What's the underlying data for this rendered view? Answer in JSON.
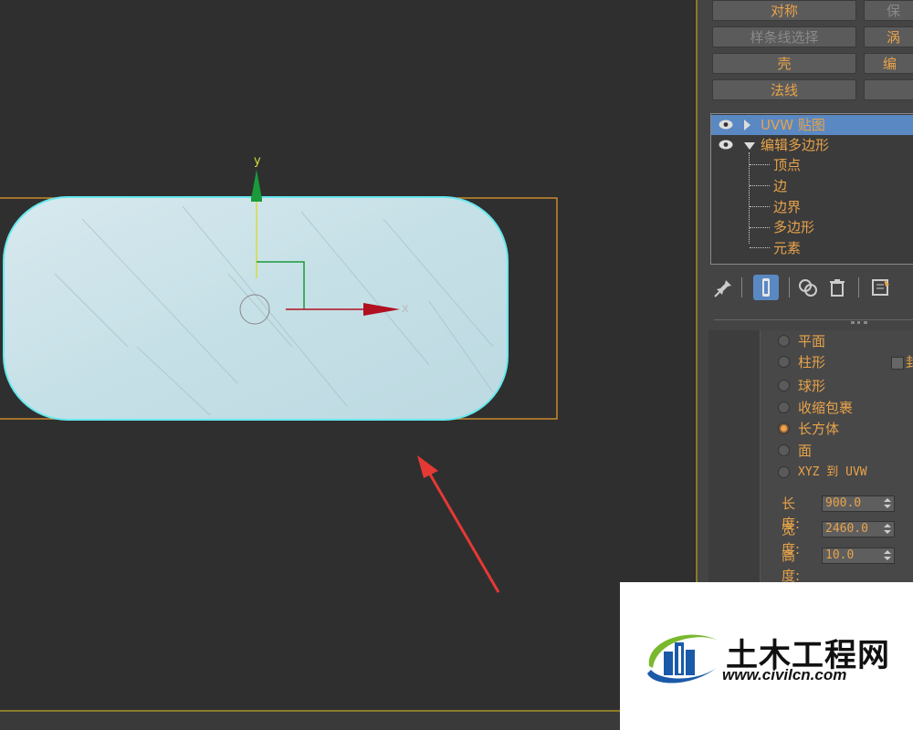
{
  "modifier_buttons": [
    {
      "label": "对称",
      "dim": false
    },
    {
      "label": "样条线选择",
      "dim": true
    },
    {
      "label": "壳",
      "dim": false
    },
    {
      "label": "法线",
      "dim": false
    }
  ],
  "modifier_buttons_right": [
    {
      "label": "保",
      "dim": true
    },
    {
      "label": "涡",
      "dim": false
    },
    {
      "label": "编",
      "dim": false
    },
    {
      "label": "",
      "dim": false
    }
  ],
  "modifier_stack": {
    "items": [
      {
        "label": "UVW 贴图",
        "selected": true
      },
      {
        "label": "编辑多边形",
        "selected": false,
        "expanded": true
      }
    ],
    "sub_items": [
      "顶点",
      "边",
      "边界",
      "多边形",
      "元素"
    ]
  },
  "mapping": {
    "options": [
      {
        "label": "平面",
        "selected": false
      },
      {
        "label": "柱形",
        "selected": false
      },
      {
        "label": "球形",
        "selected": false
      },
      {
        "label": "收缩包裹",
        "selected": false
      },
      {
        "label": "长方体",
        "selected": true
      },
      {
        "label": "面",
        "selected": false
      },
      {
        "label": "XYZ 到 UVW",
        "selected": false
      }
    ],
    "cap_label": "封"
  },
  "dimensions": {
    "length_label": "长度:",
    "length_value": "900.0",
    "width_label": "宽度:",
    "width_value": "2460.0",
    "height_label": "高度:",
    "height_value": "10.0"
  },
  "gizmo": {
    "y_label": "y",
    "x_label": "x"
  },
  "watermark": {
    "name": "土木工程网",
    "url": "www.civilcn.com"
  },
  "colors": {
    "accent_orange": "#e8a34a",
    "selection_blue": "#5a88c2",
    "annotation_red": "#e53935",
    "axis_green": "#1a9a3a",
    "axis_red": "#b01020"
  }
}
